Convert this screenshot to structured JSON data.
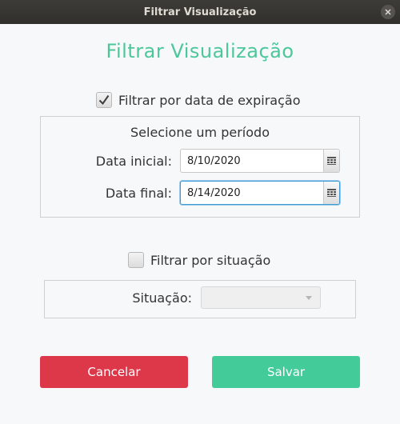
{
  "window": {
    "title": "Filtrar Visualização"
  },
  "heading": "Filtrar Visualização",
  "date_filter": {
    "checkbox_label": "Filtrar por data de expiração",
    "checked": true,
    "panel_title": "Selecione um período",
    "start_label": "Data inicial:",
    "start_value": "8/10/2020",
    "end_label": "Data final:",
    "end_value": "8/14/2020",
    "calendar_icon": "calendar-icon"
  },
  "status_filter": {
    "checkbox_label": "Filtrar por situação",
    "checked": false,
    "situation_label": "Situação:",
    "situation_value": ""
  },
  "buttons": {
    "cancel": "Cancelar",
    "save": "Salvar"
  },
  "colors": {
    "accent": "#4cc79a",
    "cancel_bg": "#dd3849",
    "save_bg": "#44cb9a",
    "focus": "#3f9bd4"
  }
}
